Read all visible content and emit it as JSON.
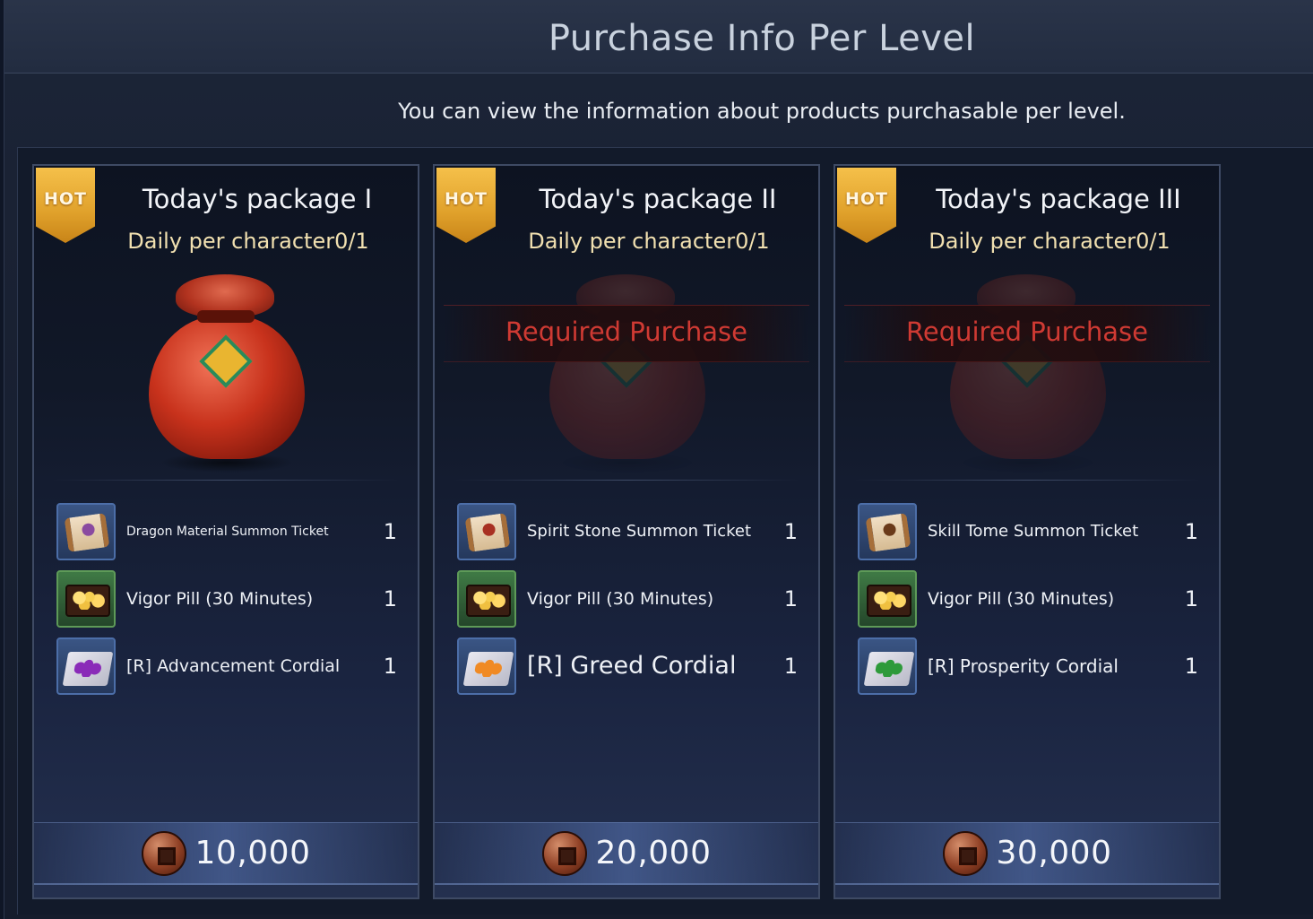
{
  "header": {
    "title": "Purchase Info Per Level",
    "subtitle": "You can view the information about products purchasable per level."
  },
  "colors": {
    "hot_badge": "#e0a12b",
    "required_text": "#cf3a33",
    "limit_text": "#f1e0b0"
  },
  "packages": [
    {
      "badge": "HOT",
      "title": "Today's package I",
      "limit": "Daily per character0/1",
      "required_purchase": "",
      "items": [
        {
          "name": "Dragon Material Summon Ticket",
          "qty": "1",
          "icon": "purple-seal-scroll-icon"
        },
        {
          "name": "Vigor Pill (30 Minutes)",
          "qty": "1",
          "icon": "gold-pill-chest-icon"
        },
        {
          "name": "[R] Advancement Cordial",
          "qty": "1",
          "icon": "purple-cordial-icon"
        }
      ],
      "price": "10,000"
    },
    {
      "badge": "HOT",
      "title": "Today's package II",
      "limit": "Daily per character0/1",
      "required_purchase": "Required Purchase",
      "items": [
        {
          "name": "Spirit Stone Summon Ticket",
          "qty": "1",
          "icon": "red-seal-scroll-icon"
        },
        {
          "name": "Vigor Pill (30 Minutes)",
          "qty": "1",
          "icon": "gold-pill-chest-icon"
        },
        {
          "name": "[R] Greed Cordial",
          "qty": "1",
          "icon": "orange-cordial-icon"
        }
      ],
      "price": "20,000"
    },
    {
      "badge": "HOT",
      "title": "Today's package III",
      "limit": "Daily per character0/1",
      "required_purchase": "Required Purchase",
      "items": [
        {
          "name": "Skill Tome Summon Ticket",
          "qty": "1",
          "icon": "brown-seal-scroll-icon"
        },
        {
          "name": "Vigor Pill (30 Minutes)",
          "qty": "1",
          "icon": "gold-pill-chest-icon"
        },
        {
          "name": "[R] Prosperity Cordial",
          "qty": "1",
          "icon": "green-cordial-icon"
        }
      ],
      "price": "30,000"
    }
  ]
}
